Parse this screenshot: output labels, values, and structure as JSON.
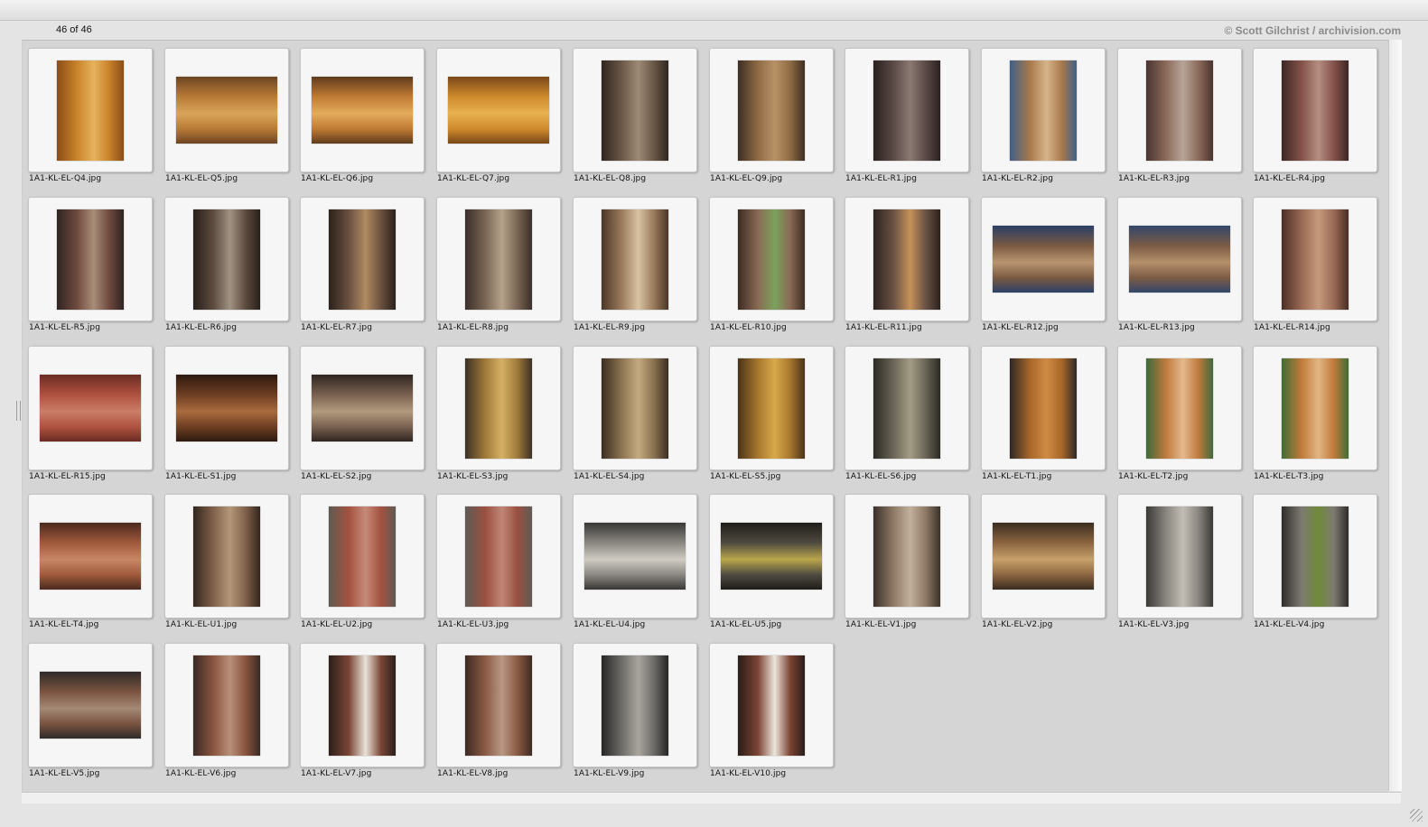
{
  "header": {
    "counter": "46 of 46",
    "credit": "© Scott Gilchrist / archivision.com"
  },
  "thumbnails": [
    {
      "filename": "1A1-KL-EL-Q4.jpg",
      "orientation": "portrait",
      "palette": [
        "#c9832a",
        "#8a4d17",
        "#e7b25e"
      ]
    },
    {
      "filename": "1A1-KL-EL-Q5.jpg",
      "orientation": "landscape",
      "palette": [
        "#b97a35",
        "#6d4522",
        "#d9a55a"
      ]
    },
    {
      "filename": "1A1-KL-EL-Q6.jpg",
      "orientation": "landscape",
      "palette": [
        "#c07b34",
        "#5f3b1d",
        "#e3ab5c"
      ]
    },
    {
      "filename": "1A1-KL-EL-Q7.jpg",
      "orientation": "landscape",
      "palette": [
        "#cf8a2c",
        "#7a4819",
        "#e8b04f"
      ]
    },
    {
      "filename": "1A1-KL-EL-Q8.jpg",
      "orientation": "portrait",
      "palette": [
        "#6b5847",
        "#2f2620",
        "#9c8a76"
      ]
    },
    {
      "filename": "1A1-KL-EL-Q9.jpg",
      "orientation": "portrait",
      "palette": [
        "#8f6b45",
        "#3d2f22",
        "#b89266"
      ]
    },
    {
      "filename": "1A1-KL-EL-R1.jpg",
      "orientation": "portrait",
      "palette": [
        "#5b4a46",
        "#2a2120",
        "#8a7a72"
      ]
    },
    {
      "filename": "1A1-KL-EL-R2.jpg",
      "orientation": "portrait",
      "palette": [
        "#a8784a",
        "#3f5f8a",
        "#d7b58c"
      ]
    },
    {
      "filename": "1A1-KL-EL-R3.jpg",
      "orientation": "portrait",
      "palette": [
        "#8c6b5b",
        "#4a3430",
        "#b7a597"
      ]
    },
    {
      "filename": "1A1-KL-EL-R4.jpg",
      "orientation": "portrait",
      "palette": [
        "#84524a",
        "#3d2724",
        "#b58e82"
      ]
    },
    {
      "filename": "1A1-KL-EL-R5.jpg",
      "orientation": "portrait",
      "palette": [
        "#6f4a3f",
        "#2f2422",
        "#a88d78"
      ]
    },
    {
      "filename": "1A1-KL-EL-R6.jpg",
      "orientation": "portrait",
      "palette": [
        "#5d4b40",
        "#282019",
        "#a09282"
      ]
    },
    {
      "filename": "1A1-KL-EL-R7.jpg",
      "orientation": "portrait",
      "palette": [
        "#6a5140",
        "#2b211b",
        "#b08a62"
      ]
    },
    {
      "filename": "1A1-KL-EL-R8.jpg",
      "orientation": "portrait",
      "palette": [
        "#7a6655",
        "#3a2f2a",
        "#b4a289"
      ]
    },
    {
      "filename": "1A1-KL-EL-R9.jpg",
      "orientation": "portrait",
      "palette": [
        "#9a7b5c",
        "#4b3628",
        "#d8c3a2"
      ]
    },
    {
      "filename": "1A1-KL-EL-R10.jpg",
      "orientation": "portrait",
      "palette": [
        "#8a6a55",
        "#3c2c22",
        "#7ba25c"
      ]
    },
    {
      "filename": "1A1-KL-EL-R11.jpg",
      "orientation": "portrait",
      "palette": [
        "#6a5245",
        "#2c221e",
        "#c6925a"
      ]
    },
    {
      "filename": "1A1-KL-EL-R12.jpg",
      "orientation": "landscape",
      "palette": [
        "#7a5a42",
        "#2b3f66",
        "#b89470"
      ]
    },
    {
      "filename": "1A1-KL-EL-R13.jpg",
      "orientation": "landscape",
      "palette": [
        "#7c5b45",
        "#33476a",
        "#b48f6a"
      ]
    },
    {
      "filename": "1A1-KL-EL-R14.jpg",
      "orientation": "portrait",
      "palette": [
        "#9a6a55",
        "#4a2e26",
        "#c59a7c"
      ]
    },
    {
      "filename": "1A1-KL-EL-R15.jpg",
      "orientation": "landscape",
      "palette": [
        "#b0523f",
        "#6a2c24",
        "#c97d68"
      ]
    },
    {
      "filename": "1A1-KL-EL-S1.jpg",
      "orientation": "landscape",
      "palette": [
        "#6e3e22",
        "#2d1a10",
        "#a96b3c"
      ]
    },
    {
      "filename": "1A1-KL-EL-S2.jpg",
      "orientation": "landscape",
      "palette": [
        "#7a6150",
        "#2f2520",
        "#b29a7e"
      ]
    },
    {
      "filename": "1A1-KL-EL-S3.jpg",
      "orientation": "portrait",
      "palette": [
        "#a07a3a",
        "#3c3126",
        "#d5b064"
      ]
    },
    {
      "filename": "1A1-KL-EL-S4.jpg",
      "orientation": "portrait",
      "palette": [
        "#8b7351",
        "#3b2e22",
        "#c4aa7f"
      ]
    },
    {
      "filename": "1A1-KL-EL-S5.jpg",
      "orientation": "portrait",
      "palette": [
        "#a7772f",
        "#4a3318",
        "#d8a94a"
      ]
    },
    {
      "filename": "1A1-KL-EL-S6.jpg",
      "orientation": "portrait",
      "palette": [
        "#6a6556",
        "#2c2a24",
        "#a39c86"
      ]
    },
    {
      "filename": "1A1-KL-EL-T1.jpg",
      "orientation": "portrait",
      "palette": [
        "#a8672a",
        "#2d2825",
        "#cf8b44"
      ]
    },
    {
      "filename": "1A1-KL-EL-T2.jpg",
      "orientation": "portrait",
      "palette": [
        "#c07a3e",
        "#3f6a3a",
        "#e4b98d"
      ]
    },
    {
      "filename": "1A1-KL-EL-T3.jpg",
      "orientation": "portrait",
      "palette": [
        "#c27a3a",
        "#3f6e34",
        "#e0b684"
      ]
    },
    {
      "filename": "1A1-KL-EL-T4.jpg",
      "orientation": "landscape",
      "palette": [
        "#a0593c",
        "#4a2a1f",
        "#c78766"
      ]
    },
    {
      "filename": "1A1-KL-EL-U1.jpg",
      "orientation": "portrait",
      "palette": [
        "#80614a",
        "#33261e",
        "#b49778"
      ]
    },
    {
      "filename": "1A1-KL-EL-U2.jpg",
      "orientation": "portrait",
      "palette": [
        "#a4523f",
        "#5f5a52",
        "#c58a78"
      ]
    },
    {
      "filename": "1A1-KL-EL-U3.jpg",
      "orientation": "portrait",
      "palette": [
        "#9a5040",
        "#5e5b55",
        "#c08676"
      ]
    },
    {
      "filename": "1A1-KL-EL-U4.jpg",
      "orientation": "landscape",
      "palette": [
        "#8a8782",
        "#3a3835",
        "#cfcbc3"
      ]
    },
    {
      "filename": "1A1-KL-EL-U5.jpg",
      "orientation": "landscape",
      "palette": [
        "#4f4a40",
        "#1f1d19",
        "#b9a64a"
      ]
    },
    {
      "filename": "1A1-KL-EL-V1.jpg",
      "orientation": "portrait",
      "palette": [
        "#8f7a66",
        "#3a312a",
        "#c1b09c"
      ]
    },
    {
      "filename": "1A1-KL-EL-V2.jpg",
      "orientation": "landscape",
      "palette": [
        "#8b6540",
        "#3a2c20",
        "#c8a06a"
      ]
    },
    {
      "filename": "1A1-KL-EL-V3.jpg",
      "orientation": "portrait",
      "palette": [
        "#8a8680",
        "#3b3936",
        "#c2bdb4"
      ]
    },
    {
      "filename": "1A1-KL-EL-V4.jpg",
      "orientation": "portrait",
      "palette": [
        "#7e7a72",
        "#2f2d2a",
        "#6f8a3a"
      ]
    },
    {
      "filename": "1A1-KL-EL-V5.jpg",
      "orientation": "landscape",
      "palette": [
        "#7a5340",
        "#2f2a28",
        "#a48a76"
      ]
    },
    {
      "filename": "1A1-KL-EL-V6.jpg",
      "orientation": "portrait",
      "palette": [
        "#8a5440",
        "#3a2a24",
        "#b8907a"
      ]
    },
    {
      "filename": "1A1-KL-EL-V7.jpg",
      "orientation": "portrait",
      "palette": [
        "#7a4636",
        "#2c1f1b",
        "#e8e2d8"
      ]
    },
    {
      "filename": "1A1-KL-EL-V8.jpg",
      "orientation": "portrait",
      "palette": [
        "#8a5a45",
        "#3e2a22",
        "#b89884"
      ]
    },
    {
      "filename": "1A1-KL-EL-V9.jpg",
      "orientation": "portrait",
      "palette": [
        "#6e6c68",
        "#262524",
        "#a9a59e"
      ]
    },
    {
      "filename": "1A1-KL-EL-V10.jpg",
      "orientation": "portrait",
      "palette": [
        "#7c4434",
        "#2b1d19",
        "#ece6dc"
      ]
    }
  ]
}
